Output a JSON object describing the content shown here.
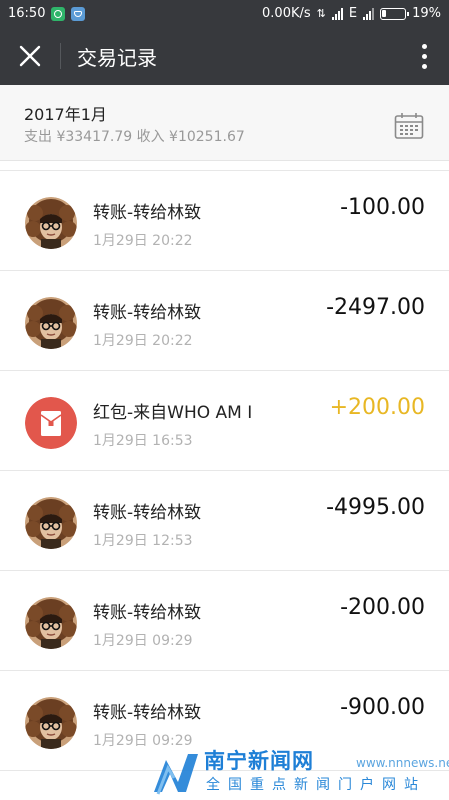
{
  "status_bar": {
    "time": "16:50",
    "speed": "0.00K/s",
    "network_type": "E",
    "battery_percent": "19%",
    "battery_level": 0.19
  },
  "app_bar": {
    "title": "交易记录",
    "close_icon": "close-icon",
    "more_icon": "more-vertical-icon"
  },
  "summary": {
    "month": "2017年1月",
    "stats": "支出 ¥33417.79 收入 ¥10251.67",
    "calendar_icon": "calendar-icon"
  },
  "transactions": [
    {
      "title": "转账-转给林致",
      "time": "1月29日 20:22",
      "amount": "-100.00",
      "type": "transfer"
    },
    {
      "title": "转账-转给林致",
      "time": "1月29日 20:22",
      "amount": "-2497.00",
      "type": "transfer"
    },
    {
      "title": "红包-来自WHO AM I",
      "time": "1月29日 16:53",
      "amount": "+200.00",
      "type": "red-packet"
    },
    {
      "title": "转账-转给林致",
      "time": "1月29日 12:53",
      "amount": "-4995.00",
      "type": "transfer"
    },
    {
      "title": "转账-转给林致",
      "time": "1月29日 09:29",
      "amount": "-200.00",
      "type": "transfer"
    },
    {
      "title": "转账-转给林致",
      "time": "1月29日 09:29",
      "amount": "-900.00",
      "type": "transfer"
    }
  ],
  "colors": {
    "header_bg": "#37393d",
    "income": "#e8b724",
    "red_packet": "#e2574c"
  },
  "watermark": {
    "name": "南宁新闻网",
    "url": "www.nnnews.net",
    "tagline": "全国重点新闻门户网站"
  }
}
